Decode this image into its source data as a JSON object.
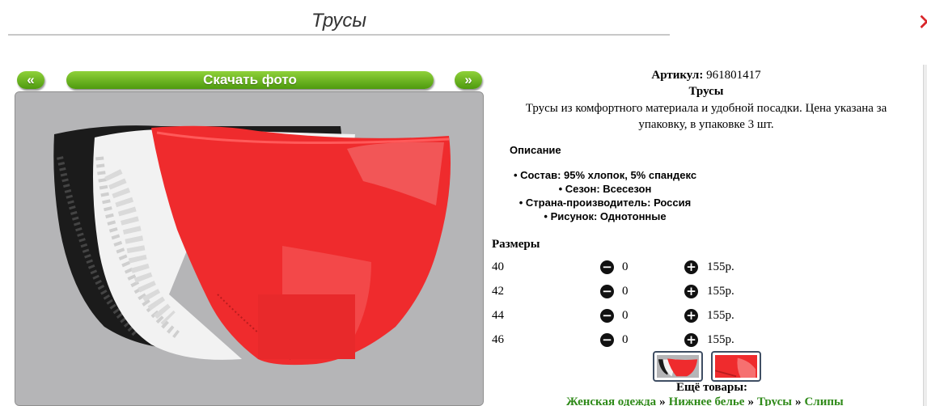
{
  "page": {
    "title": "Трусы"
  },
  "nav": {
    "prev_label": "«",
    "download_label": "Скачать фото",
    "next_label": "»"
  },
  "product": {
    "article_label": "Артикул:",
    "article_value": "961801417",
    "name": "Трусы",
    "description": "Трусы из комфортного материала и удобной посадки. Цена указана за упаковку, в упаковке 3 шт.",
    "description_heading": "Описание",
    "specs": [
      "Состав: 95% хлопок, 5% спандекс",
      "Сезон: Всесезон",
      "Страна-производитель: Россия",
      "Рисунок: Однотонные"
    ]
  },
  "sizes": {
    "heading": "Размеры",
    "rows": [
      {
        "size": "40",
        "qty": "0",
        "price": "155р."
      },
      {
        "size": "42",
        "qty": "0",
        "price": "155р."
      },
      {
        "size": "44",
        "qty": "0",
        "price": "155р."
      },
      {
        "size": "46",
        "qty": "0",
        "price": "155р."
      }
    ],
    "minus_symbol": "−",
    "plus_symbol": "+"
  },
  "more": {
    "heading": "Ещё товары:",
    "links": [
      "Женская одежда",
      "Нижнее белье",
      "Трусы",
      "Слипы"
    ],
    "separator": "»"
  },
  "icons": {
    "close": "close-icon",
    "minus": "minus-circle-icon",
    "plus": "plus-circle-icon"
  },
  "colors": {
    "accent_green": "#5aa514",
    "link_green": "#2f8a19",
    "photo_bg": "#b5b5b7",
    "product_red": "#ef2b2d"
  }
}
